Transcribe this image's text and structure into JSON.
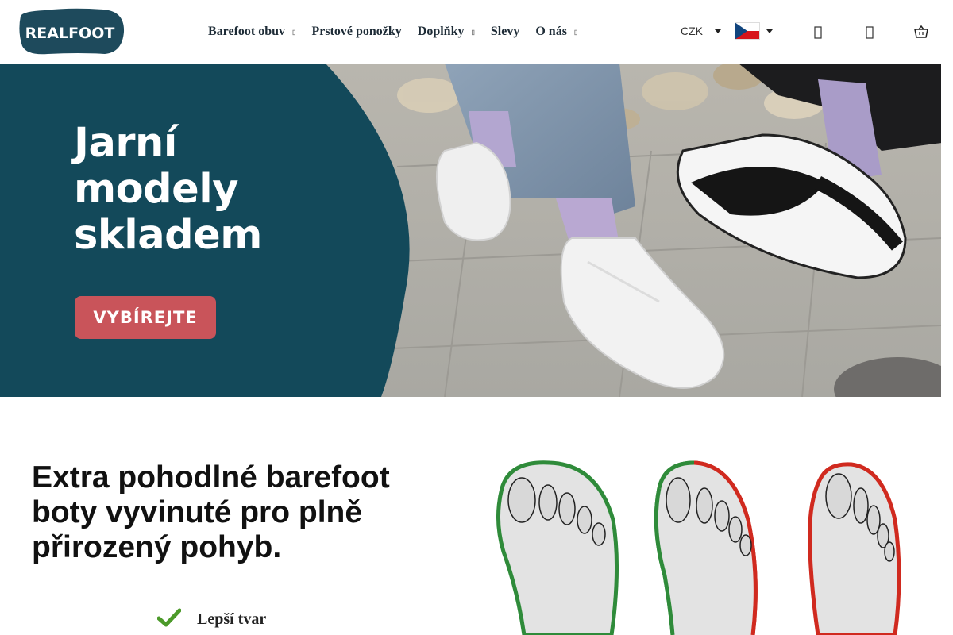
{
  "header": {
    "logo_text": "REALFOOT",
    "nav": [
      {
        "label": "Barefoot obuv",
        "has_dropdown": true
      },
      {
        "label": "Prstové ponožky",
        "has_dropdown": false
      },
      {
        "label": "Doplňky",
        "has_dropdown": true
      },
      {
        "label": "Slevy",
        "has_dropdown": false
      },
      {
        "label": "O nás",
        "has_dropdown": true
      }
    ],
    "currency": "CZK",
    "language_flag": "cz-flag-icon",
    "icons": [
      "search-icon",
      "user-icon",
      "cart-icon"
    ]
  },
  "hero": {
    "title_lines": [
      "Jarní",
      "modely",
      "skladem"
    ],
    "button_label": "VYBÍREJTE",
    "colors": {
      "panel": "#13495a",
      "button": "#c9545a"
    }
  },
  "content": {
    "headline": "Extra pohodlné barefoot boty vyvinuté pro plně přirozený pohyb.",
    "benefits": [
      {
        "label": "Lepší tvar",
        "icon": "check-icon"
      }
    ],
    "illustration": "foot-shape-comparison"
  },
  "colors": {
    "nav_text": "#1d2b36",
    "good_outline": "#2f8b3a",
    "bad_outline": "#d02a1f",
    "check": "#4c9a2a"
  }
}
